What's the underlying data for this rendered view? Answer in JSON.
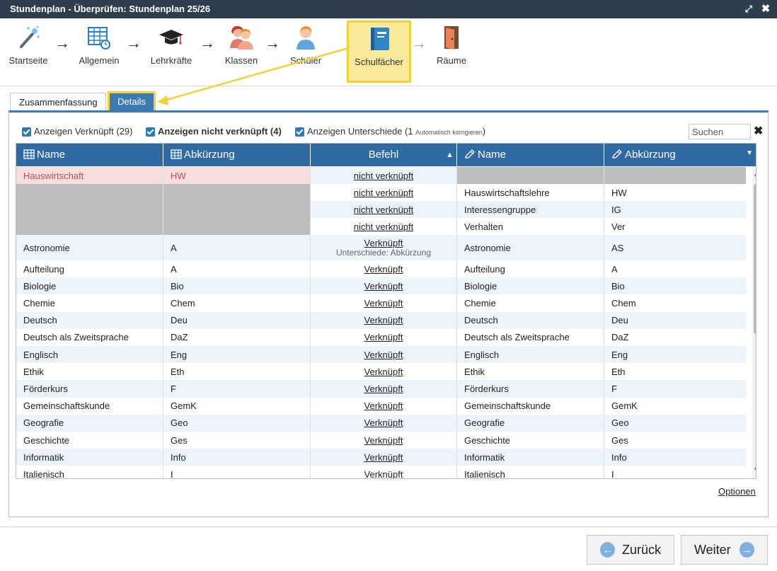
{
  "window": {
    "title": "Stundenplan - Überprüfen: Stundenplan 25/26",
    "expand_icon": "⤢",
    "close_icon": "✖"
  },
  "wizard": {
    "steps": [
      {
        "label": "Startseite",
        "icon": "magic-wand-icon"
      },
      {
        "label": "Allgemein",
        "icon": "calendar-grid-icon"
      },
      {
        "label": "Lehrkräfte",
        "icon": "graduation-cap-icon"
      },
      {
        "label": "Klassen",
        "icon": "people-icon"
      },
      {
        "label": "Schüler",
        "icon": "student-icon"
      },
      {
        "label": "Schulfächer",
        "icon": "book-icon",
        "active": true
      },
      {
        "label": "Räume",
        "icon": "door-icon"
      }
    ],
    "arrow": "→"
  },
  "tabs": [
    {
      "label": "Zusammenfassung"
    },
    {
      "label": "Details",
      "active": true
    }
  ],
  "filters": {
    "linked": {
      "label": "Anzeigen Verknüpft (29)",
      "checked": true
    },
    "unlinked": {
      "label": "Anzeigen nicht verknüpft (4)",
      "checked": true
    },
    "differences": {
      "label": "Anzeigen Unterschiede (1",
      "note": "Automatisch korrigieren",
      "close": ")",
      "checked": true
    }
  },
  "search": {
    "placeholder": "Suchen",
    "clear_icon": "✖"
  },
  "grid": {
    "columns": [
      "Name",
      "Abkürzung",
      "Befehl",
      "Name",
      "Abkürzung"
    ],
    "sort_indicator": "▲",
    "menu_indicator": "▼",
    "rows": [
      {
        "left_name": "Hauswirtschaft",
        "left_abbr": "HW",
        "command": "nicht verknüpft",
        "sub": "",
        "right_name": "",
        "right_abbr": "",
        "state": "left-only"
      },
      {
        "left_name": "",
        "left_abbr": "",
        "command": "nicht verknüpft",
        "sub": "",
        "right_name": "Hauswirtschaftslehre",
        "right_abbr": "HW",
        "state": "right-only"
      },
      {
        "left_name": "",
        "left_abbr": "",
        "command": "nicht verknüpft",
        "sub": "",
        "right_name": "Interessengruppe",
        "right_abbr": "IG",
        "state": "right-only"
      },
      {
        "left_name": "",
        "left_abbr": "",
        "command": "nicht verknüpft",
        "sub": "",
        "right_name": "Verhalten",
        "right_abbr": "Ver",
        "state": "right-only"
      },
      {
        "left_name": "Astronomie",
        "left_abbr": "A",
        "command": "Verknüpft",
        "sub": "Unterschiede: Abkürzung",
        "right_name": "Astronomie",
        "right_abbr": "AS",
        "state": "linked"
      },
      {
        "left_name": "Aufteilung",
        "left_abbr": "A",
        "command": "Verknüpft",
        "sub": "",
        "right_name": "Aufteilung",
        "right_abbr": "A",
        "state": "linked"
      },
      {
        "left_name": "Biologie",
        "left_abbr": "Bio",
        "command": "Verknüpft",
        "sub": "",
        "right_name": "Biologie",
        "right_abbr": "Bio",
        "state": "linked"
      },
      {
        "left_name": "Chemie",
        "left_abbr": "Chem",
        "command": "Verknüpft",
        "sub": "",
        "right_name": "Chemie",
        "right_abbr": "Chem",
        "state": "linked"
      },
      {
        "left_name": "Deutsch",
        "left_abbr": "Deu",
        "command": "Verknüpft",
        "sub": "",
        "right_name": "Deutsch",
        "right_abbr": "Deu",
        "state": "linked"
      },
      {
        "left_name": "Deutsch als Zweitsprache",
        "left_abbr": "DaZ",
        "command": "Verknüpft",
        "sub": "",
        "right_name": "Deutsch als Zweitsprache",
        "right_abbr": "DaZ",
        "state": "linked"
      },
      {
        "left_name": "Englisch",
        "left_abbr": "Eng",
        "command": "Verknüpft",
        "sub": "",
        "right_name": "Englisch",
        "right_abbr": "Eng",
        "state": "linked"
      },
      {
        "left_name": "Ethik",
        "left_abbr": "Eth",
        "command": "Verknüpft",
        "sub": "",
        "right_name": "Ethik",
        "right_abbr": "Eth",
        "state": "linked"
      },
      {
        "left_name": "Förderkurs",
        "left_abbr": "F",
        "command": "Verknüpft",
        "sub": "",
        "right_name": "Förderkurs",
        "right_abbr": "F",
        "state": "linked"
      },
      {
        "left_name": "Gemeinschaftskunde",
        "left_abbr": "GemK",
        "command": "Verknüpft",
        "sub": "",
        "right_name": "Gemeinschaftskunde",
        "right_abbr": "GemK",
        "state": "linked"
      },
      {
        "left_name": "Geografie",
        "left_abbr": "Geo",
        "command": "Verknüpft",
        "sub": "",
        "right_name": "Geografie",
        "right_abbr": "Geo",
        "state": "linked"
      },
      {
        "left_name": "Geschichte",
        "left_abbr": "Ges",
        "command": "Verknüpft",
        "sub": "",
        "right_name": "Geschichte",
        "right_abbr": "Ges",
        "state": "linked"
      },
      {
        "left_name": "Informatik",
        "left_abbr": "Info",
        "command": "Verknüpft",
        "sub": "",
        "right_name": "Informatik",
        "right_abbr": "Info",
        "state": "linked"
      },
      {
        "left_name": "Italienisch",
        "left_abbr": "I",
        "command": "Verknüpft",
        "sub": "",
        "right_name": "Italienisch",
        "right_abbr": "I",
        "state": "linked"
      }
    ]
  },
  "options_link": "Optionen",
  "footer": {
    "back_label": "Zurück",
    "next_label": "Weiter",
    "back_icon": "←",
    "next_icon": "→"
  },
  "colors": {
    "titlebar": "#2f3e4d",
    "header": "#2f6aa3",
    "highlight": "#f2d23b",
    "unlinked_text": "#c0504d"
  }
}
